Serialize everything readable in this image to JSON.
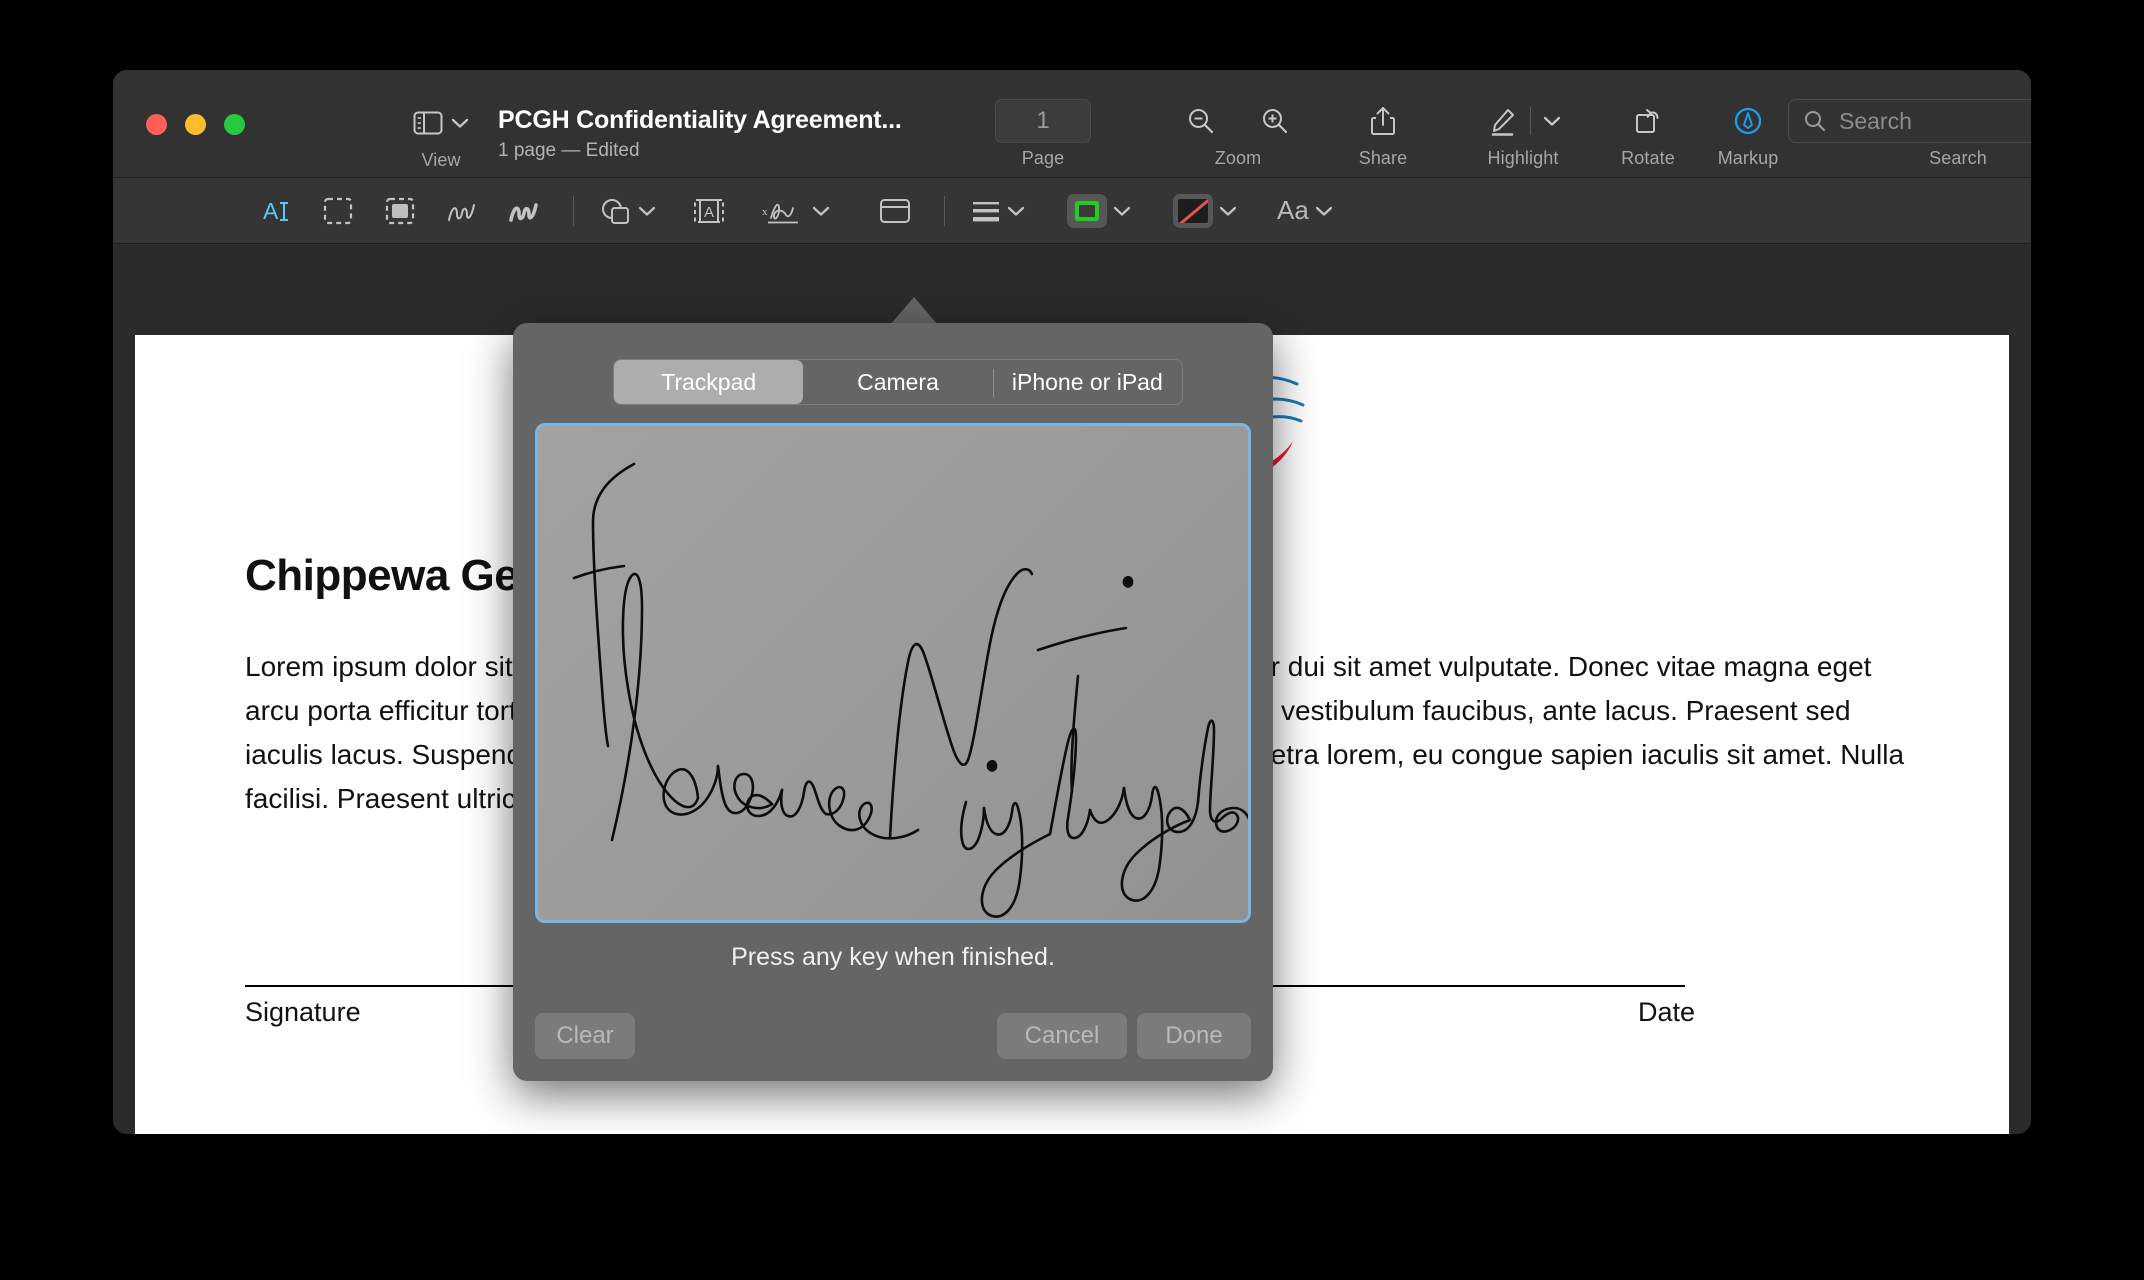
{
  "window": {
    "title": "PCGH Confidentiality Agreement...",
    "subtitle": "1 page — Edited"
  },
  "toolbar": {
    "view_label": "View",
    "view_icon": "sidebar-icon",
    "page_label": "Page",
    "page_value": "1",
    "zoom_label": "Zoom",
    "zoom_out_icon": "zoom-out-icon",
    "zoom_in_icon": "zoom-in-icon",
    "share_label": "Share",
    "share_icon": "share-icon",
    "highlight_label": "Highlight",
    "highlight_icon": "highlighter-pen-icon",
    "rotate_label": "Rotate",
    "rotate_icon": "rotate-icon",
    "markup_label": "Markup",
    "markup_icon": "markup-pen-circle-icon",
    "search_label": "Search",
    "search_placeholder": "Search",
    "search_value": "",
    "search_icon": "search-icon"
  },
  "markup_toolbar": {
    "items": [
      {
        "name": "text-selection-tool",
        "icon": "text-cursor-icon",
        "active": true
      },
      {
        "name": "rectangular-selection-tool",
        "icon": "dashed-rectangle-icon",
        "active": false
      },
      {
        "name": "instant-alpha-tool",
        "icon": "filled-dashed-rectangle-icon",
        "active": false
      },
      {
        "name": "sketch-tool",
        "icon": "squiggle-thin-icon",
        "active": false
      },
      {
        "name": "draw-tool",
        "icon": "squiggle-thick-icon",
        "active": false
      },
      {
        "name": "shapes-tool",
        "icon": "shapes-icon",
        "active": false
      },
      {
        "name": "text-tool",
        "icon": "text-box-icon",
        "active": false
      },
      {
        "name": "sign-tool",
        "icon": "signature-icon",
        "active": false
      },
      {
        "name": "note-tool",
        "icon": "note-icon",
        "active": false
      },
      {
        "name": "shape-style-tool",
        "icon": "lines-icon",
        "active": false
      },
      {
        "name": "border-color-tool",
        "icon": "green-swatch-icon",
        "active": false
      },
      {
        "name": "fill-color-tool",
        "icon": "no-fill-swatch-icon",
        "active": false
      },
      {
        "name": "font-tool",
        "icon": "Aa",
        "label": "Aa",
        "active": false
      }
    ],
    "font_label": "Aa"
  },
  "popover": {
    "tabs": [
      {
        "label": "Trackpad",
        "active": true
      },
      {
        "label": "Camera",
        "active": false
      },
      {
        "label": "iPhone or iPad",
        "active": false
      }
    ],
    "signature_text": "Florence Nightingale",
    "hint": "Press any key when finished.",
    "buttons": {
      "clear": "Clear",
      "cancel": "Cancel",
      "done": "Done"
    },
    "pad_border_color": "#7fb4e0"
  },
  "document": {
    "logo_name": "chippewa-hospital-logo",
    "heading": "Chippewa General Hospital",
    "body": "Lorem ipsum dolor sit amet, consectetur adipiscing elit. Suspendisse gravida auctor dui sit amet vulputate. Donec vitae magna eget arcu porta efficitur tortor id justo commodo bibendum. Donec condimentum, nisl vel vestibulum faucibus, ante lacus. Praesent sed iaculis lacus. Suspendisse a lorem vel velit dignissim consequat. Sed pulvinar pharetra lorem, eu congue sapien iaculis sit amet. Nulla facilisi. Praesent ultrices nulla efficitur dui eleifend iaculis sit amet non quam.",
    "signature_label": "Signature",
    "date_label": "Date"
  },
  "colors": {
    "accent_blue": "#1b8ad4",
    "logo_red": "#ec1c24",
    "markup_active": "#5ac8fa",
    "swatch_green": "#22cc22"
  }
}
